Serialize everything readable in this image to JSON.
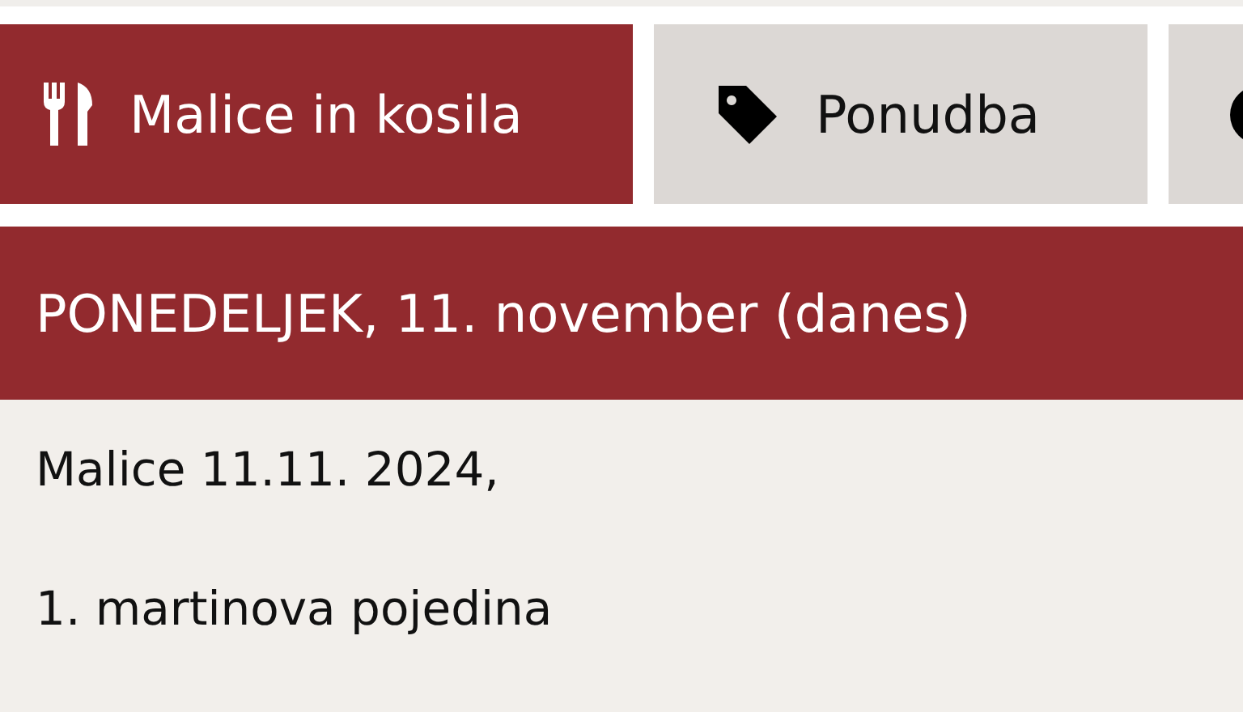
{
  "tabs": [
    {
      "kind": "meals",
      "label": "Malice in kosila",
      "selected": true
    },
    {
      "kind": "offer",
      "label": "Ponudba",
      "selected": false
    },
    {
      "kind": "other",
      "selected": false
    }
  ],
  "day_heading": "PONEDELJEK, 11. november (danes)",
  "menu_lines": [
    "Malice 11.11. 2024,",
    "1. martinova pojedina"
  ]
}
